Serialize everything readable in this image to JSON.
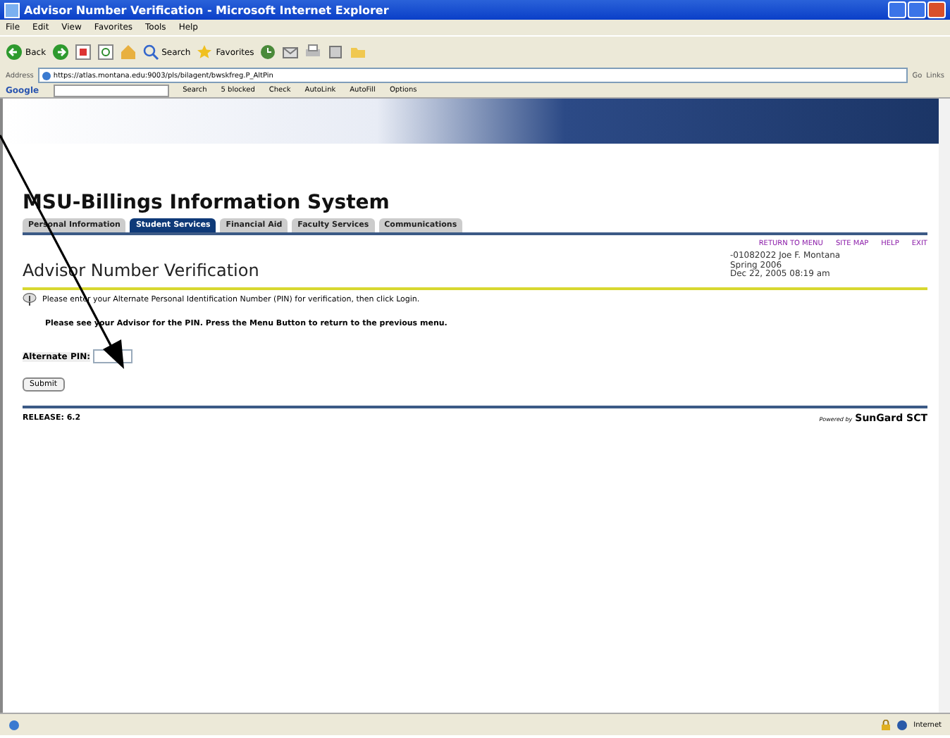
{
  "window": {
    "title": "Advisor Number Verification - Microsoft Internet Explorer"
  },
  "menu": [
    "File",
    "Edit",
    "View",
    "Favorites",
    "Tools",
    "Help"
  ],
  "toolbar": [
    {
      "kind": "back",
      "label": "Back"
    },
    {
      "kind": "forward"
    },
    {
      "kind": "stop"
    },
    {
      "kind": "refresh"
    },
    {
      "kind": "home"
    },
    {
      "kind": "search",
      "label": "Search"
    },
    {
      "kind": "favorites",
      "label": "Favorites"
    },
    {
      "kind": "history"
    },
    {
      "kind": "mail"
    },
    {
      "kind": "print"
    },
    {
      "kind": "edit"
    },
    {
      "kind": "folder"
    }
  ],
  "address": {
    "label": "Address",
    "value": "https://atlas.montana.edu:9003/pls/bilagent/bwskfreg.P_AltPin",
    "go": "Go",
    "links": "Links"
  },
  "google_bar": {
    "logo": "Google",
    "items": [
      "Search",
      "5 blocked",
      "Check",
      "AutoLink",
      "AutoFill",
      "Options"
    ]
  },
  "site": {
    "title": "MSU-Billings Information System",
    "tabs": [
      {
        "label": "Personal Information",
        "selected": false
      },
      {
        "label": "Student Services",
        "selected": true
      },
      {
        "label": "Financial Aid",
        "selected": false
      },
      {
        "label": "Faculty Services",
        "selected": false
      },
      {
        "label": "Communications",
        "selected": false
      }
    ],
    "links": [
      "RETURN TO MENU",
      "SITE MAP",
      "HELP",
      "EXIT"
    ],
    "page_title": "Advisor Number Verification",
    "user_info": [
      "-01082022 Joe F. Montana",
      "Spring 2006",
      "Dec 22, 2005 08:19 am"
    ],
    "info": "Please enter your Alternate Personal Identification Number (PIN) for verification, then click Login.",
    "note": "Please see your Advisor for the PIN. Press the Menu Button to return to the previous menu.",
    "pin_label": "Alternate PIN:",
    "submit": "Submit",
    "release": "RELEASE: 6.2",
    "powered_by": "Powered by",
    "brand": "SunGard SCT"
  },
  "status_bar": {
    "zone": "Internet"
  }
}
